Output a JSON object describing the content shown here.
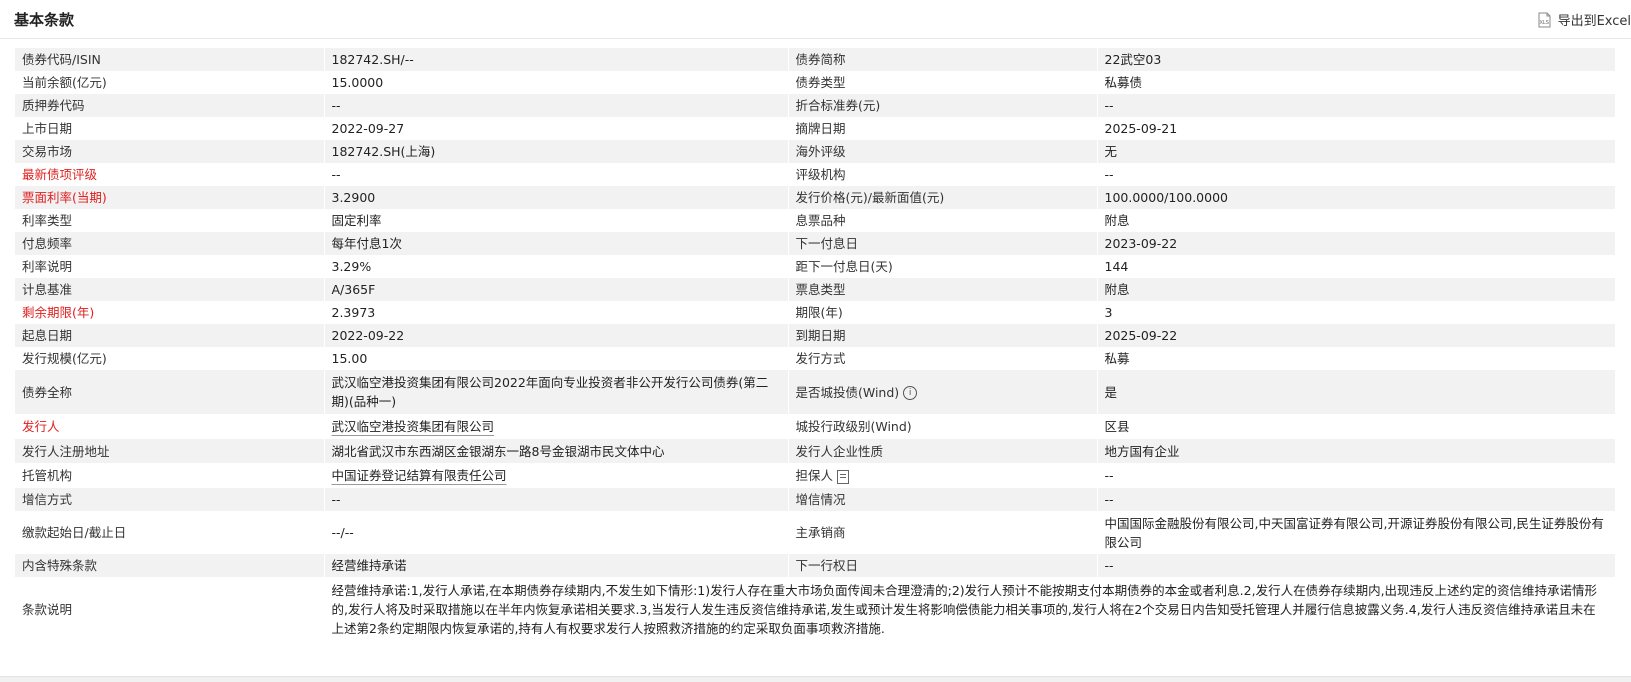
{
  "header": {
    "title": "基本条款",
    "export_label": "导出到Excel",
    "export_icon": "xls-icon"
  },
  "rows": [
    {
      "l1": "债券代码/ISIN",
      "v1": "182742.SH/--",
      "l2": "债券简称",
      "v2": "22武空03"
    },
    {
      "l1": "当前余额(亿元)",
      "v1": "15.0000",
      "l2": "债券类型",
      "v2": "私募债"
    },
    {
      "l1": "质押券代码",
      "v1": "--",
      "l2": "折合标准券(元)",
      "v2": "--"
    },
    {
      "l1": "上市日期",
      "v1": "2022-09-27",
      "l2": "摘牌日期",
      "v2": "2025-09-21"
    },
    {
      "l1": "交易市场",
      "v1": "182742.SH(上海)",
      "l2": "海外评级",
      "v2": "无"
    },
    {
      "l1": "最新债项评级",
      "v1": "--",
      "l2": "评级机构",
      "v2": "--"
    },
    {
      "l1": "票面利率(当期)",
      "v1": "3.2900",
      "l2": "发行价格(元)/最新面值(元)",
      "v2": "100.0000/100.0000"
    },
    {
      "l1": "利率类型",
      "v1": "固定利率",
      "l2": "息票品种",
      "v2": "附息"
    },
    {
      "l1": "付息频率",
      "v1": "每年付息1次",
      "l2": "下一付息日",
      "v2": "2023-09-22"
    },
    {
      "l1": "利率说明",
      "v1": "3.29%",
      "l2": "距下一付息日(天)",
      "v2": "144"
    },
    {
      "l1": "计息基准",
      "v1": "A/365F",
      "l2": "票息类型",
      "v2": "附息"
    },
    {
      "l1": "剩余期限(年)",
      "v1": "2.3973",
      "l2": "期限(年)",
      "v2": "3"
    },
    {
      "l1": "起息日期",
      "v1": "2022-09-22",
      "l2": "到期日期",
      "v2": "2025-09-22"
    },
    {
      "l1": "发行规模(亿元)",
      "v1": "15.00",
      "l2": "发行方式",
      "v2": "私募"
    },
    {
      "l1": "债券全称",
      "v1": "武汉临空港投资集团有限公司2022年面向专业投资者非公开发行公司债券(第二期)(品种一)",
      "l2": "是否城投债(Wind)",
      "v2": "是"
    },
    {
      "l1": "发行人",
      "v1": "武汉临空港投资集团有限公司",
      "l2": "城投行政级别(Wind)",
      "v2": "区县"
    },
    {
      "l1": "发行人注册地址",
      "v1": "湖北省武汉市东西湖区金银湖东一路8号金银湖市民文体中心",
      "l2": "发行人企业性质",
      "v2": "地方国有企业"
    },
    {
      "l1": "托管机构",
      "v1": "中国证券登记结算有限责任公司",
      "l2": "担保人",
      "v2": "--"
    },
    {
      "l1": "增信方式",
      "v1": "--",
      "l2": "增信情况",
      "v2": "--"
    },
    {
      "l1": "缴款起始日/截止日",
      "v1": "--/--",
      "l2": "主承销商",
      "v2": "中国国际金融股份有限公司,中天国富证券有限公司,开源证券股份有限公司,民生证券股份有限公司"
    },
    {
      "l1": "内含特殊条款",
      "v1": "经营维持承诺",
      "l2": "下一行权日",
      "v2": "--"
    }
  ],
  "terms_note": {
    "label": "条款说明",
    "text": "经营维持承诺:1,发行人承诺,在本期债券存续期内,不发生如下情形:1)发行人存在重大市场负面传闻未合理澄清的;2)发行人预计不能按期支付本期债券的本金或者利息.2,发行人在债券存续期内,出现违反上述约定的资信维持承诺情形的,发行人将及时采取措施以在半年内恢复承诺相关要求.3,当发行人发生违反资信维持承诺,发生或预计发生将影响偿债能力相关事项的,发行人将在2个交易日内告知受托管理人并履行信息披露义务.4,发行人违反资信维持承诺且未在上述第2条约定期限内恢复承诺的,持有人有权要求发行人按照救济措施的约定采取负面事项救济措施."
  },
  "colors": {
    "red_label": "#e02020",
    "row_alt": "#f2f2f2"
  },
  "icons": {
    "info": "info-icon",
    "guarantor": "document-icon"
  }
}
